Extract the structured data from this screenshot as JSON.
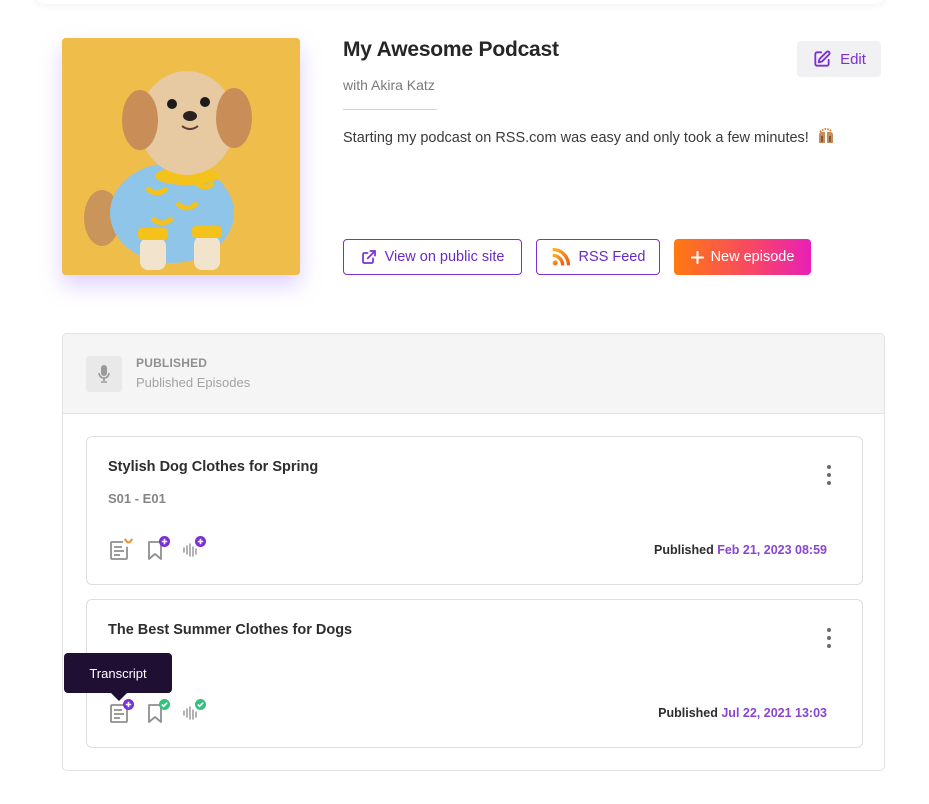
{
  "podcast": {
    "title": "My Awesome Podcast",
    "subtitle": "with Akira Katz",
    "description": "Starting my podcast on RSS.com was easy and only took a few minutes!",
    "cover_alt": "Dog wearing banana-print shirt on yellow background",
    "emoji": "raised-hands"
  },
  "actions": {
    "edit_label": "Edit",
    "view_public_label": "View on public site",
    "rss_label": "RSS Feed",
    "new_episode_label": "New episode"
  },
  "section": {
    "title": "PUBLISHED",
    "subtitle": "Published Episodes",
    "icon": "microphone-icon"
  },
  "episodes": [
    {
      "title": "Stylish Dog Clothes for Spring",
      "number": "S01 - E01",
      "status_label": "Published",
      "date": "Feb 21, 2023 08:59",
      "icons": [
        {
          "name": "transcript-icon",
          "badge": "pending",
          "badge_color": "#f28c28"
        },
        {
          "name": "chapters-icon",
          "badge": "add",
          "badge_color": "#7b2fd6"
        },
        {
          "name": "soundbite-icon",
          "badge": "add",
          "badge_color": "#7b2fd6"
        }
      ]
    },
    {
      "title": "The Best Summer Clothes for Dogs",
      "number": "",
      "status_label": "Published",
      "date": "Jul 22, 2021 13:03",
      "icons": [
        {
          "name": "transcript-icon",
          "badge": "add",
          "badge_color": "#7b2fd6"
        },
        {
          "name": "chapters-icon",
          "badge": "done",
          "badge_color": "#2ec47a"
        },
        {
          "name": "soundbite-icon",
          "badge": "done",
          "badge_color": "#2ec47a"
        }
      ]
    }
  ],
  "tooltip": {
    "text": "Transcript"
  },
  "colors": {
    "accent": "#7b2fd6",
    "date": "#8a45d0",
    "gradient_start": "#ff7a0f",
    "gradient_end": "#e91fb8",
    "success": "#2ec47a",
    "warning": "#f28c28",
    "tooltip_bg": "#1e0f33"
  }
}
